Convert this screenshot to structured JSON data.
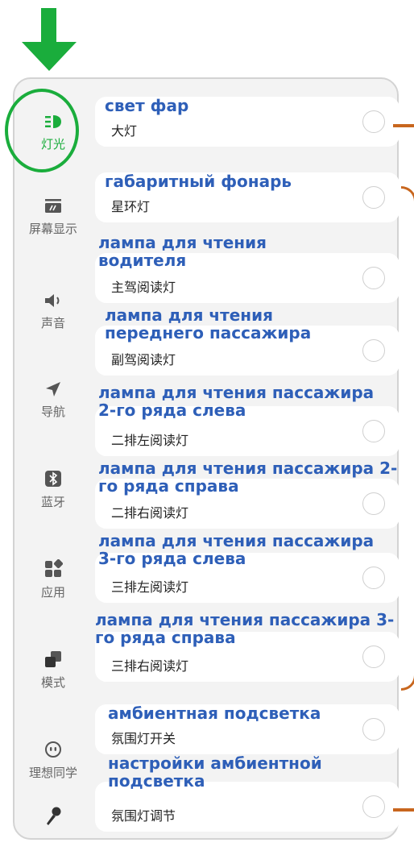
{
  "sidebar": {
    "items": [
      {
        "label": "灯光",
        "icon": "headlight-icon",
        "active": true
      },
      {
        "label": "屏幕显示",
        "icon": "screen-icon"
      },
      {
        "label": "声音",
        "icon": "speaker-icon"
      },
      {
        "label": "导航",
        "icon": "navigation-arrow-icon"
      },
      {
        "label": "蓝牙",
        "icon": "bluetooth-icon"
      },
      {
        "label": "应用",
        "icon": "apps-icon"
      },
      {
        "label": "模式",
        "icon": "mode-icon"
      },
      {
        "label": "理想同学",
        "icon": "assistant-face-icon"
      },
      {
        "label": "",
        "icon": "microphone-icon"
      }
    ]
  },
  "settings": [
    {
      "label": "大灯",
      "annotation": "свет фар"
    },
    {
      "label": "星环灯",
      "annotation": "габаритный фонарь"
    },
    {
      "label": "主驾阅读灯",
      "annotation": "лампа для чтения водителя"
    },
    {
      "label": "副驾阅读灯",
      "annotation": "лампа для чтения переднего пассажира"
    },
    {
      "label": "二排左阅读灯",
      "annotation": "лампа для чтения пассажира 2-го ряда слева"
    },
    {
      "label": "二排右阅读灯",
      "annotation": "лампа для чтения пассажира 2-го ряда справа"
    },
    {
      "label": "三排左阅读灯",
      "annotation": "лампа для чтения пассажира 3-го ряда слева"
    },
    {
      "label": "三排右阅读灯",
      "annotation": "лампа для чтения пассажира 3-го ряда справа"
    },
    {
      "label": "氛围灯开关",
      "annotation": "амбиентная подсветка"
    },
    {
      "label": "氛围灯调节",
      "annotation": "настройки амбиентной подсветка"
    }
  ],
  "colors": {
    "accent_green": "#1aad3c",
    "annotation_blue": "#2e5fb8",
    "bracket_orange": "#c8661e"
  }
}
